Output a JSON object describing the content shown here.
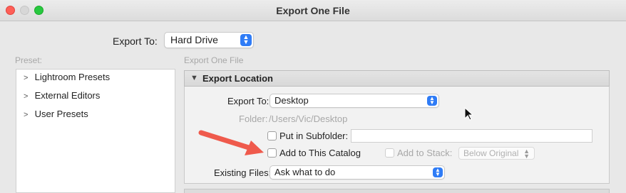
{
  "window": {
    "title": "Export One File"
  },
  "export_to": {
    "label": "Export To:",
    "value": "Hard Drive"
  },
  "preset": {
    "header": "Preset:",
    "items": [
      {
        "label": "Lightroom Presets"
      },
      {
        "label": "External Editors"
      },
      {
        "label": "User Presets"
      }
    ]
  },
  "main": {
    "header": "Export One File",
    "section": {
      "title": "Export Location",
      "export_to_label": "Export To:",
      "export_to_value": "Desktop",
      "folder_label": "Folder:",
      "folder_value": "/Users/Vic/Desktop",
      "subfolder_label": "Put in Subfolder:",
      "subfolder_value": "",
      "add_catalog_label": "Add to This Catalog",
      "add_stack_label": "Add to Stack:",
      "stack_value": "Below Original",
      "existing_files_label": "Existing Files:",
      "existing_files_value": "Ask what to do"
    }
  },
  "colors": {
    "accent": "#2f7cf6",
    "annotation_arrow": "#ef5a4c"
  }
}
